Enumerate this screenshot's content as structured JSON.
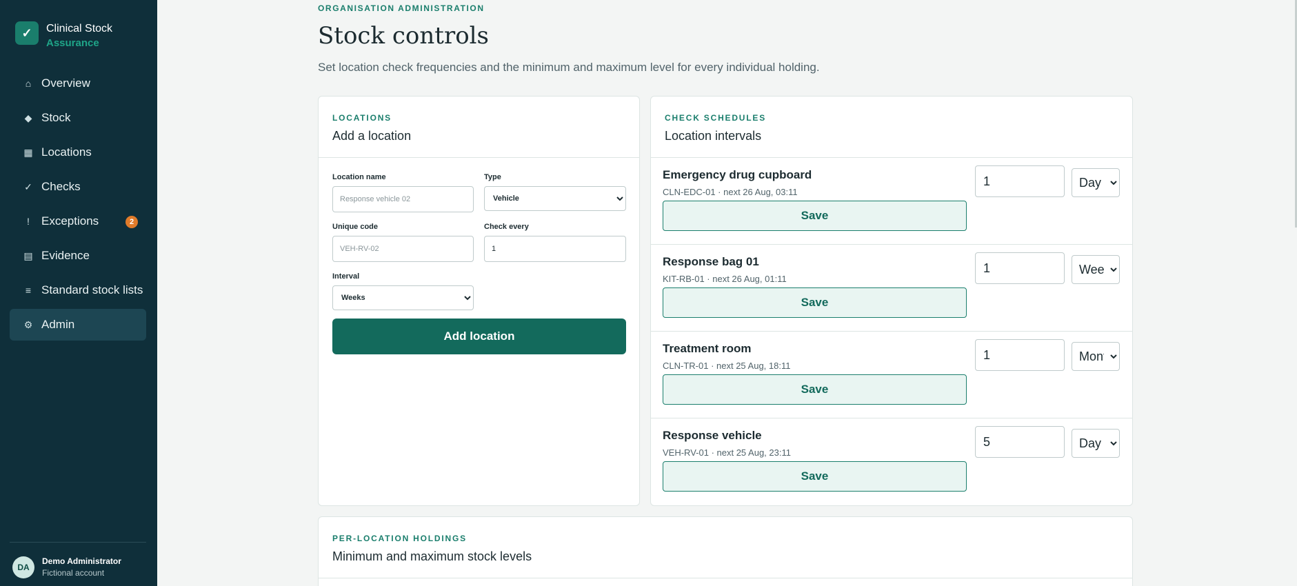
{
  "brand": {
    "logo_glyph": "✓",
    "name": "Clinical Stock",
    "sub": "Assurance"
  },
  "nav": [
    {
      "icon": "⌂",
      "icon_name": "home-icon",
      "label": "Overview"
    },
    {
      "icon": "◆",
      "icon_name": "stock-icon",
      "label": "Stock"
    },
    {
      "icon": "▦",
      "icon_name": "locations-icon",
      "label": "Locations"
    },
    {
      "icon": "✓",
      "icon_name": "checks-icon",
      "label": "Checks"
    },
    {
      "icon": "!",
      "icon_name": "exceptions-icon",
      "label": "Exceptions",
      "badge": "2"
    },
    {
      "icon": "▤",
      "icon_name": "evidence-icon",
      "label": "Evidence"
    },
    {
      "icon": "≡",
      "icon_name": "list-icon",
      "label": "Standard stock lists"
    },
    {
      "icon": "⚙",
      "icon_name": "gear-icon",
      "label": "Admin",
      "active": true
    }
  ],
  "user": {
    "initials": "DA",
    "name": "Demo Administrator",
    "role": "Fictional account"
  },
  "page": {
    "eyebrow": "ORGANISATION ADMINISTRATION",
    "title": "Stock controls",
    "description": "Set location check frequencies and the minimum and maximum level for every individual holding."
  },
  "locations_card": {
    "eyebrow": "LOCATIONS",
    "title": "Add a location",
    "name_label": "Location name",
    "name_placeholder": "Response vehicle 02",
    "type_label": "Type",
    "type_value": "Vehicle",
    "code_label": "Unique code",
    "code_placeholder": "VEH-RV-02",
    "check_label": "Check every",
    "check_value": "1",
    "interval_label": "Interval",
    "interval_value": "Weeks",
    "add_button": "Add location"
  },
  "schedules_card": {
    "eyebrow": "CHECK SCHEDULES",
    "title": "Location intervals",
    "save_label": "Save",
    "rows": [
      {
        "name": "Emergency drug cupboard",
        "meta": "CLN-EDC-01 · next 26 Aug, 03:11",
        "every": "1",
        "unit": "Day"
      },
      {
        "name": "Response bag 01",
        "meta": "KIT-RB-01 · next 26 Aug, 01:11",
        "every": "1",
        "unit": "Week"
      },
      {
        "name": "Treatment room",
        "meta": "CLN-TR-01 · next 25 Aug, 18:11",
        "every": "1",
        "unit": "Month"
      },
      {
        "name": "Response vehicle",
        "meta": "VEH-RV-01 · next 25 Aug, 23:11",
        "every": "5",
        "unit": "Day"
      }
    ]
  },
  "holdings_card": {
    "eyebrow": "PER-LOCATION HOLDINGS",
    "title": "Minimum and maximum stock levels"
  }
}
